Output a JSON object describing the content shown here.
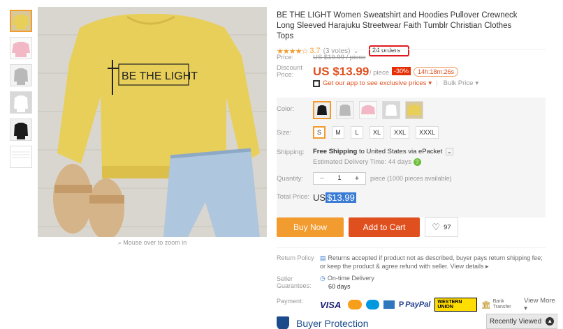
{
  "product": {
    "title": "BE THE LIGHT Women Sweatshirt and Hoodies Pullover Crewneck Long Sleeved Harajuku Streetwear Faith Tumblr Christian Clothes Tops",
    "print_text": "BE THE LIGHT",
    "zoom_hint": "Mouse over to zoom in",
    "rating": "3.7",
    "votes": "(3 votes)",
    "orders": "24 orders"
  },
  "price": {
    "label": "Price:",
    "original": "US $19.99 / piece",
    "discount_label": "Discount Price:",
    "current": "US $13.99",
    "per": "/ piece",
    "percent_off": "-30%",
    "timer": "14h:18m:26s",
    "app_text": "Get our app to see exclusive prices",
    "bulk": "Bulk Price"
  },
  "options": {
    "color_label": "Color:",
    "size_label": "Size:",
    "sizes": [
      "S",
      "M",
      "L",
      "XL",
      "XXL",
      "XXXL"
    ],
    "selected_size": "S",
    "shipping_label": "Shipping:",
    "shipping_free": "Free Shipping",
    "shipping_rest": "to United States via ePacket",
    "delivery": "Estimated Delivery Time: 44 days",
    "quantity_label": "Quantity:",
    "quantity": "1",
    "quantity_note": "piece (1000 pieces available)",
    "total_label": "Total Price:",
    "total_prefix": "US",
    "total_value": "$13.99"
  },
  "actions": {
    "buy_now": "Buy Now",
    "add_to_cart": "Add to Cart",
    "wishlist_count": "97"
  },
  "policy": {
    "return_label": "Return Policy",
    "return_text": "Returns accepted if product not as described, buyer pays return shipping fee; or keep the product & agree refund with seller.",
    "view_details": "View details",
    "guarantee_label": "Seller Guarantees:",
    "on_time": "On-time Delivery",
    "days": "60 days",
    "payment_label": "Payment:",
    "visa": "VISA",
    "paypal": "PayPal",
    "western_union": "WESTERN UNION",
    "bank_transfer": "Bank Transfer",
    "view_more": "View More",
    "buyer_protection": "Buyer Protection"
  },
  "recently_viewed": "Recently Viewed",
  "colors": {
    "accent_orange": "#f29b2e",
    "price_red": "#e0501f",
    "sweatshirt_yellow": "#e8cf5a",
    "orders_outline": "#e0191f"
  }
}
